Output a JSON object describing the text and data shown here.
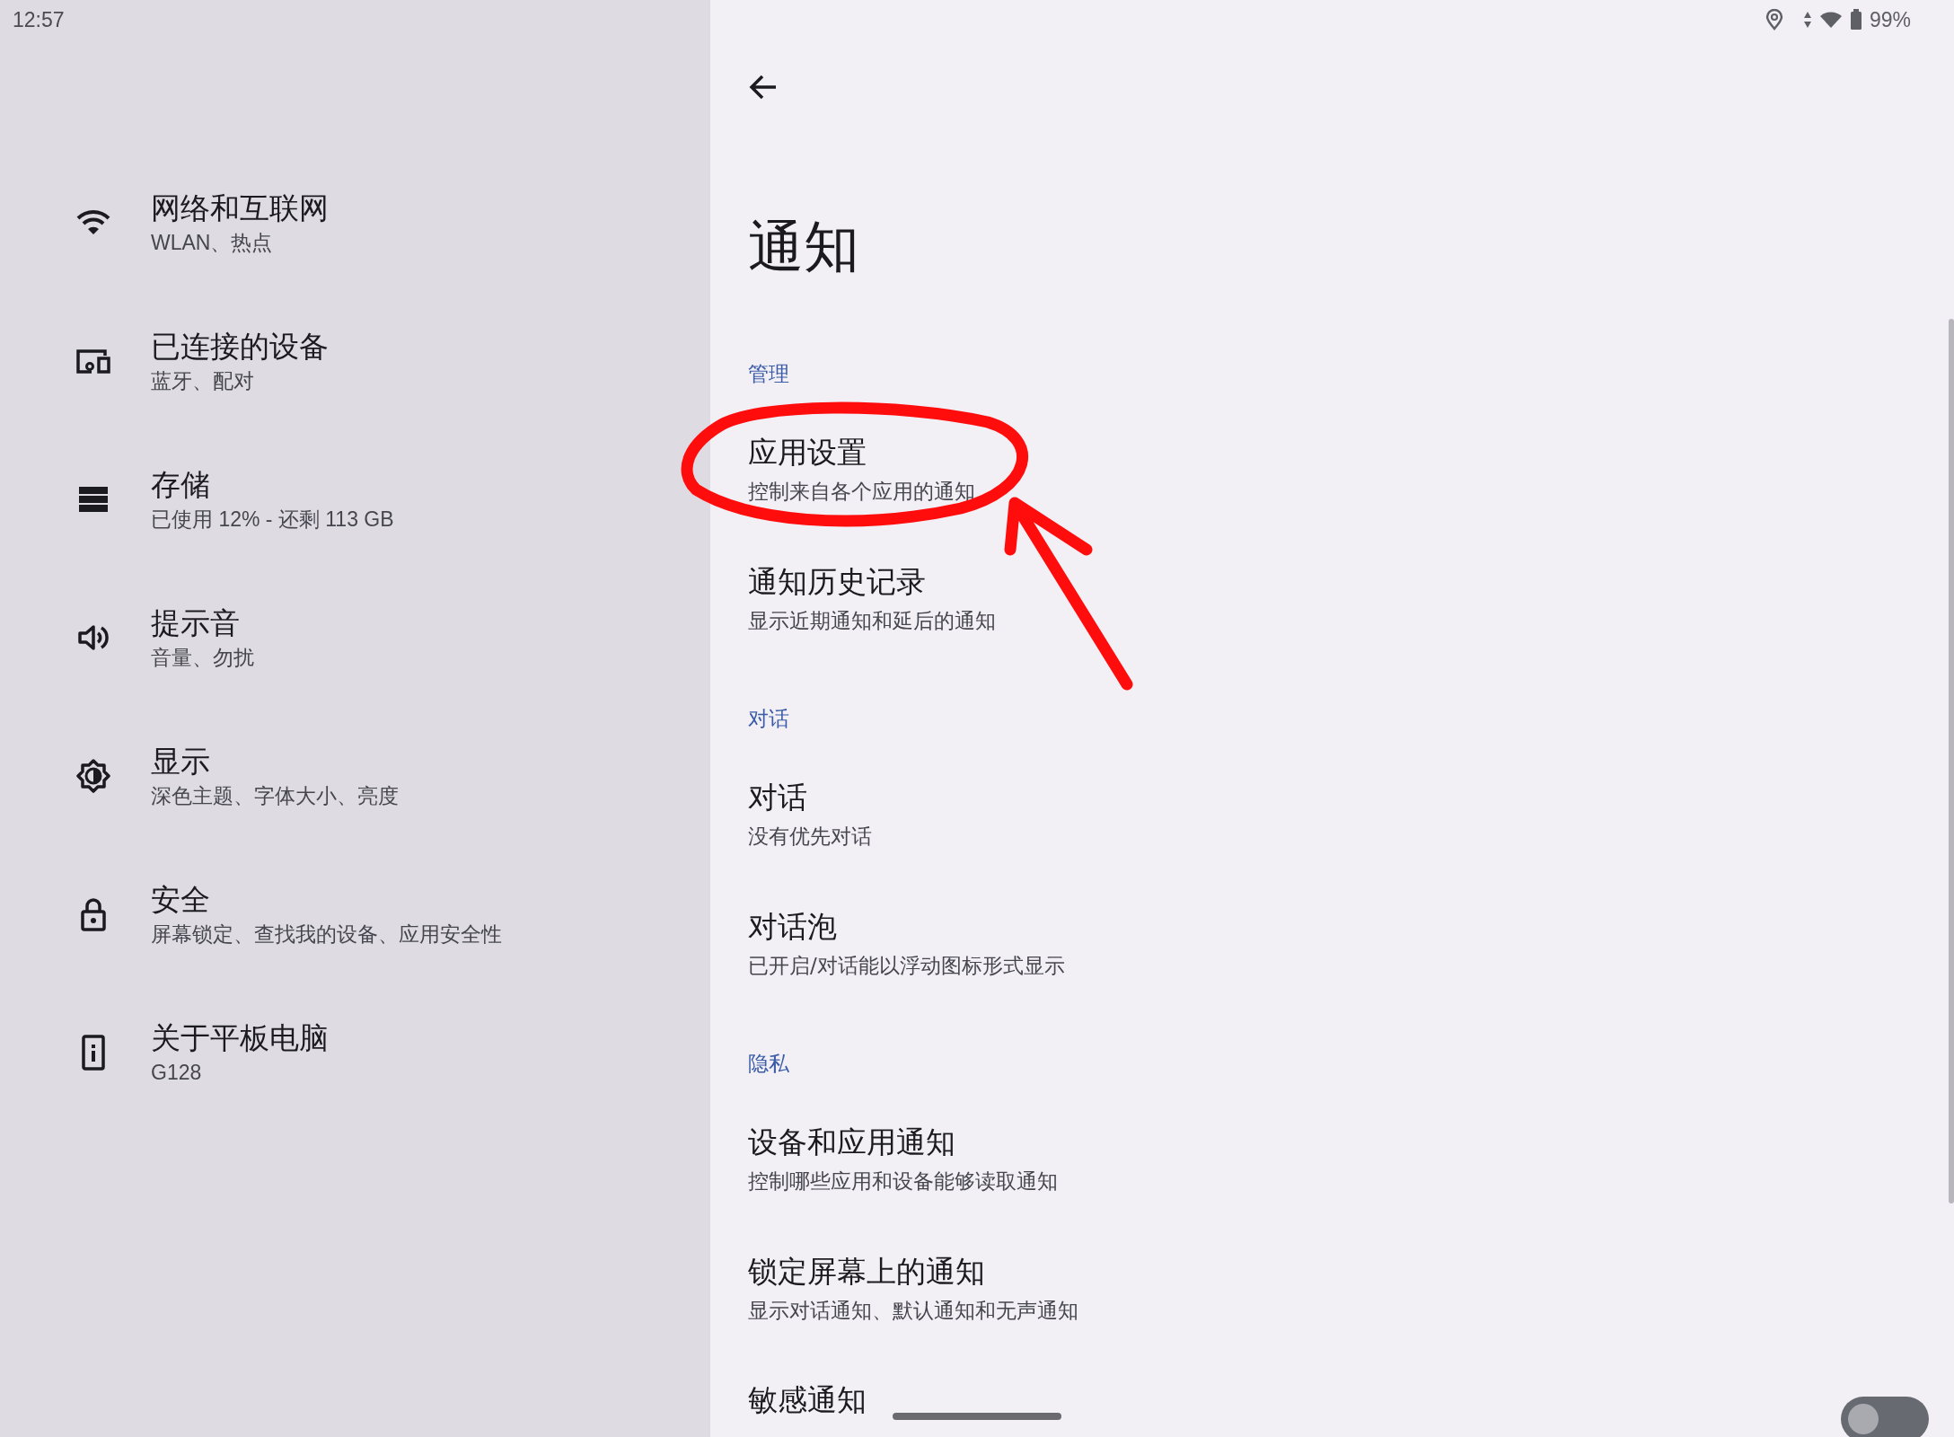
{
  "status_bar": {
    "time": "12:57",
    "battery": "99%"
  },
  "sidebar": {
    "items": [
      {
        "title": "网络和互联网",
        "subtitle": "WLAN、热点"
      },
      {
        "title": "已连接的设备",
        "subtitle": "蓝牙、配对"
      },
      {
        "title": "存储",
        "subtitle": "已使用 12% - 还剩 113 GB"
      },
      {
        "title": "提示音",
        "subtitle": "音量、勿扰"
      },
      {
        "title": "显示",
        "subtitle": "深色主题、字体大小、亮度"
      },
      {
        "title": "安全",
        "subtitle": "屏幕锁定、查找我的设备、应用安全性"
      },
      {
        "title": "关于平板电脑",
        "subtitle": "G128"
      }
    ]
  },
  "page": {
    "title": "通知",
    "sections": [
      {
        "heading": "管理",
        "items": [
          {
            "kind": "link",
            "title": "应用设置",
            "subtitle": "控制来自各个应用的通知"
          },
          {
            "kind": "link",
            "title": "通知历史记录",
            "subtitle": "显示近期通知和延后的通知"
          }
        ]
      },
      {
        "heading": "对话",
        "items": [
          {
            "kind": "link",
            "title": "对话",
            "subtitle": "没有优先对话"
          },
          {
            "kind": "link",
            "title": "对话泡",
            "subtitle": "已开启/对话能以浮动图标形式显示"
          }
        ]
      },
      {
        "heading": "隐私",
        "items": [
          {
            "kind": "link",
            "title": "设备和应用通知",
            "subtitle": "控制哪些应用和设备能够读取通知"
          },
          {
            "kind": "link",
            "title": "锁定屏幕上的通知",
            "subtitle": "显示对话通知、默认通知和无声通知"
          },
          {
            "kind": "toggle",
            "title": "敏感通知",
            "on": false
          }
        ]
      }
    ]
  }
}
